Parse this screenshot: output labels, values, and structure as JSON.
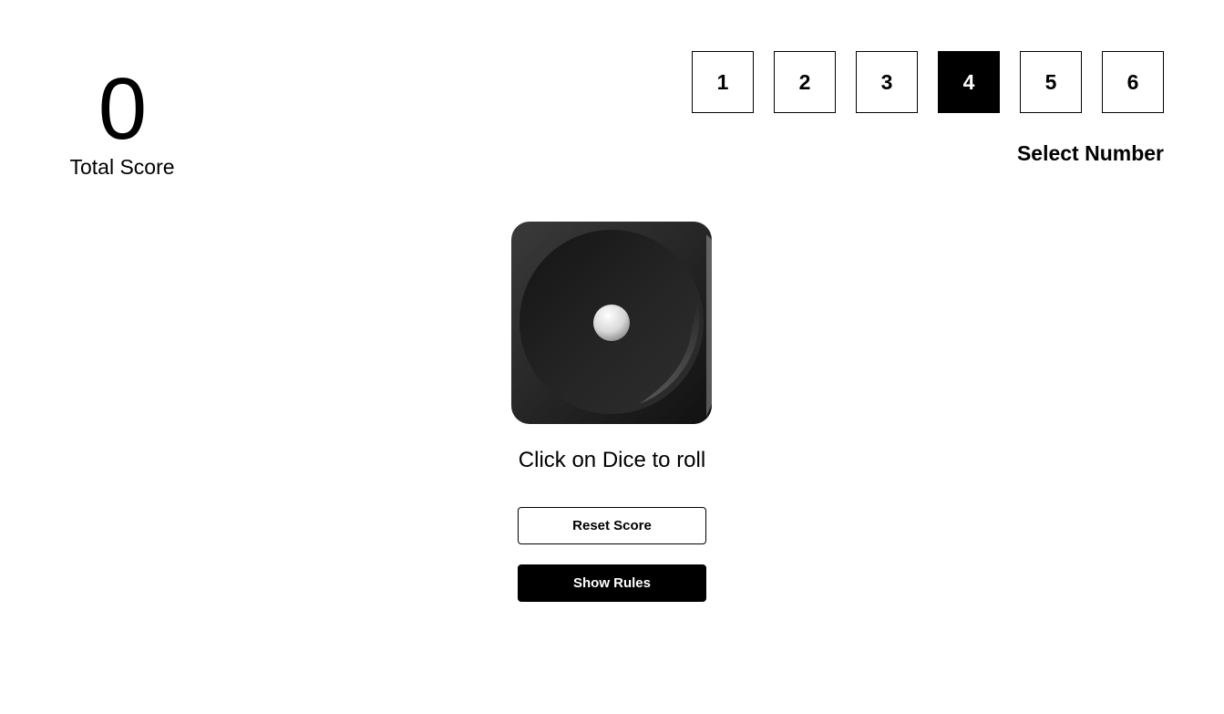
{
  "score": {
    "value": "0",
    "label": "Total Score"
  },
  "number_selector": {
    "numbers": [
      "1",
      "2",
      "3",
      "4",
      "5",
      "6"
    ],
    "selected": "4",
    "label": "Select Number"
  },
  "dice": {
    "face_value": 1,
    "hint": "Click on Dice to roll"
  },
  "buttons": {
    "reset_label": "Reset Score",
    "rules_label": "Show Rules"
  },
  "colors": {
    "primary": "#000000",
    "background": "#ffffff",
    "selected_text": "#ffffff"
  }
}
